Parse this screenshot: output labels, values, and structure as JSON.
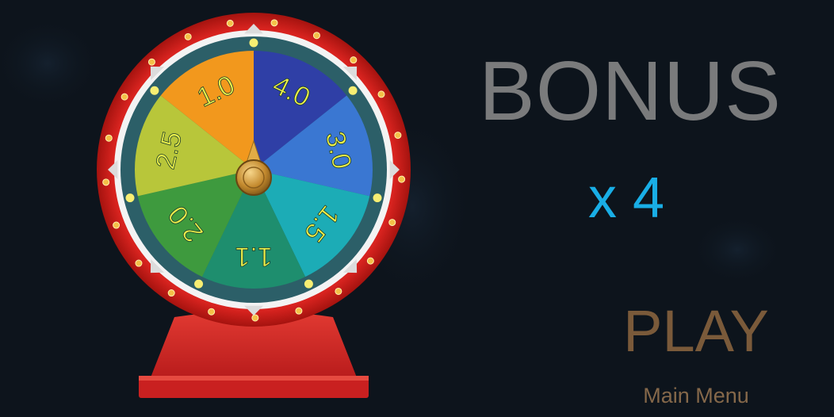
{
  "wheel": {
    "segments": [
      {
        "label": "4.0",
        "color": "#2f3fa6"
      },
      {
        "label": "3.0",
        "color": "#3a77d2"
      },
      {
        "label": "1.5",
        "color": "#1cacb6"
      },
      {
        "label": "1.1",
        "color": "#1e8e6e"
      },
      {
        "label": "2.0",
        "color": "#3e9a3e"
      },
      {
        "label": "2.5",
        "color": "#b8c63a"
      },
      {
        "label": "1.0",
        "color": "#f2981d"
      }
    ],
    "label_color": "#ecf04a",
    "rim_color": "#d8231f",
    "stand_color": "#cf2424"
  },
  "bonus": {
    "title": "BONUS",
    "multiplier": "x 4"
  },
  "menu": {
    "play_label": "PLAY",
    "main_menu_label": "Main Menu"
  },
  "colors": {
    "background": "#0d141c",
    "title": "#7a7b7c",
    "multiplier": "#19aee6",
    "play": "#7a5a3a",
    "main_menu": "#85684a"
  }
}
